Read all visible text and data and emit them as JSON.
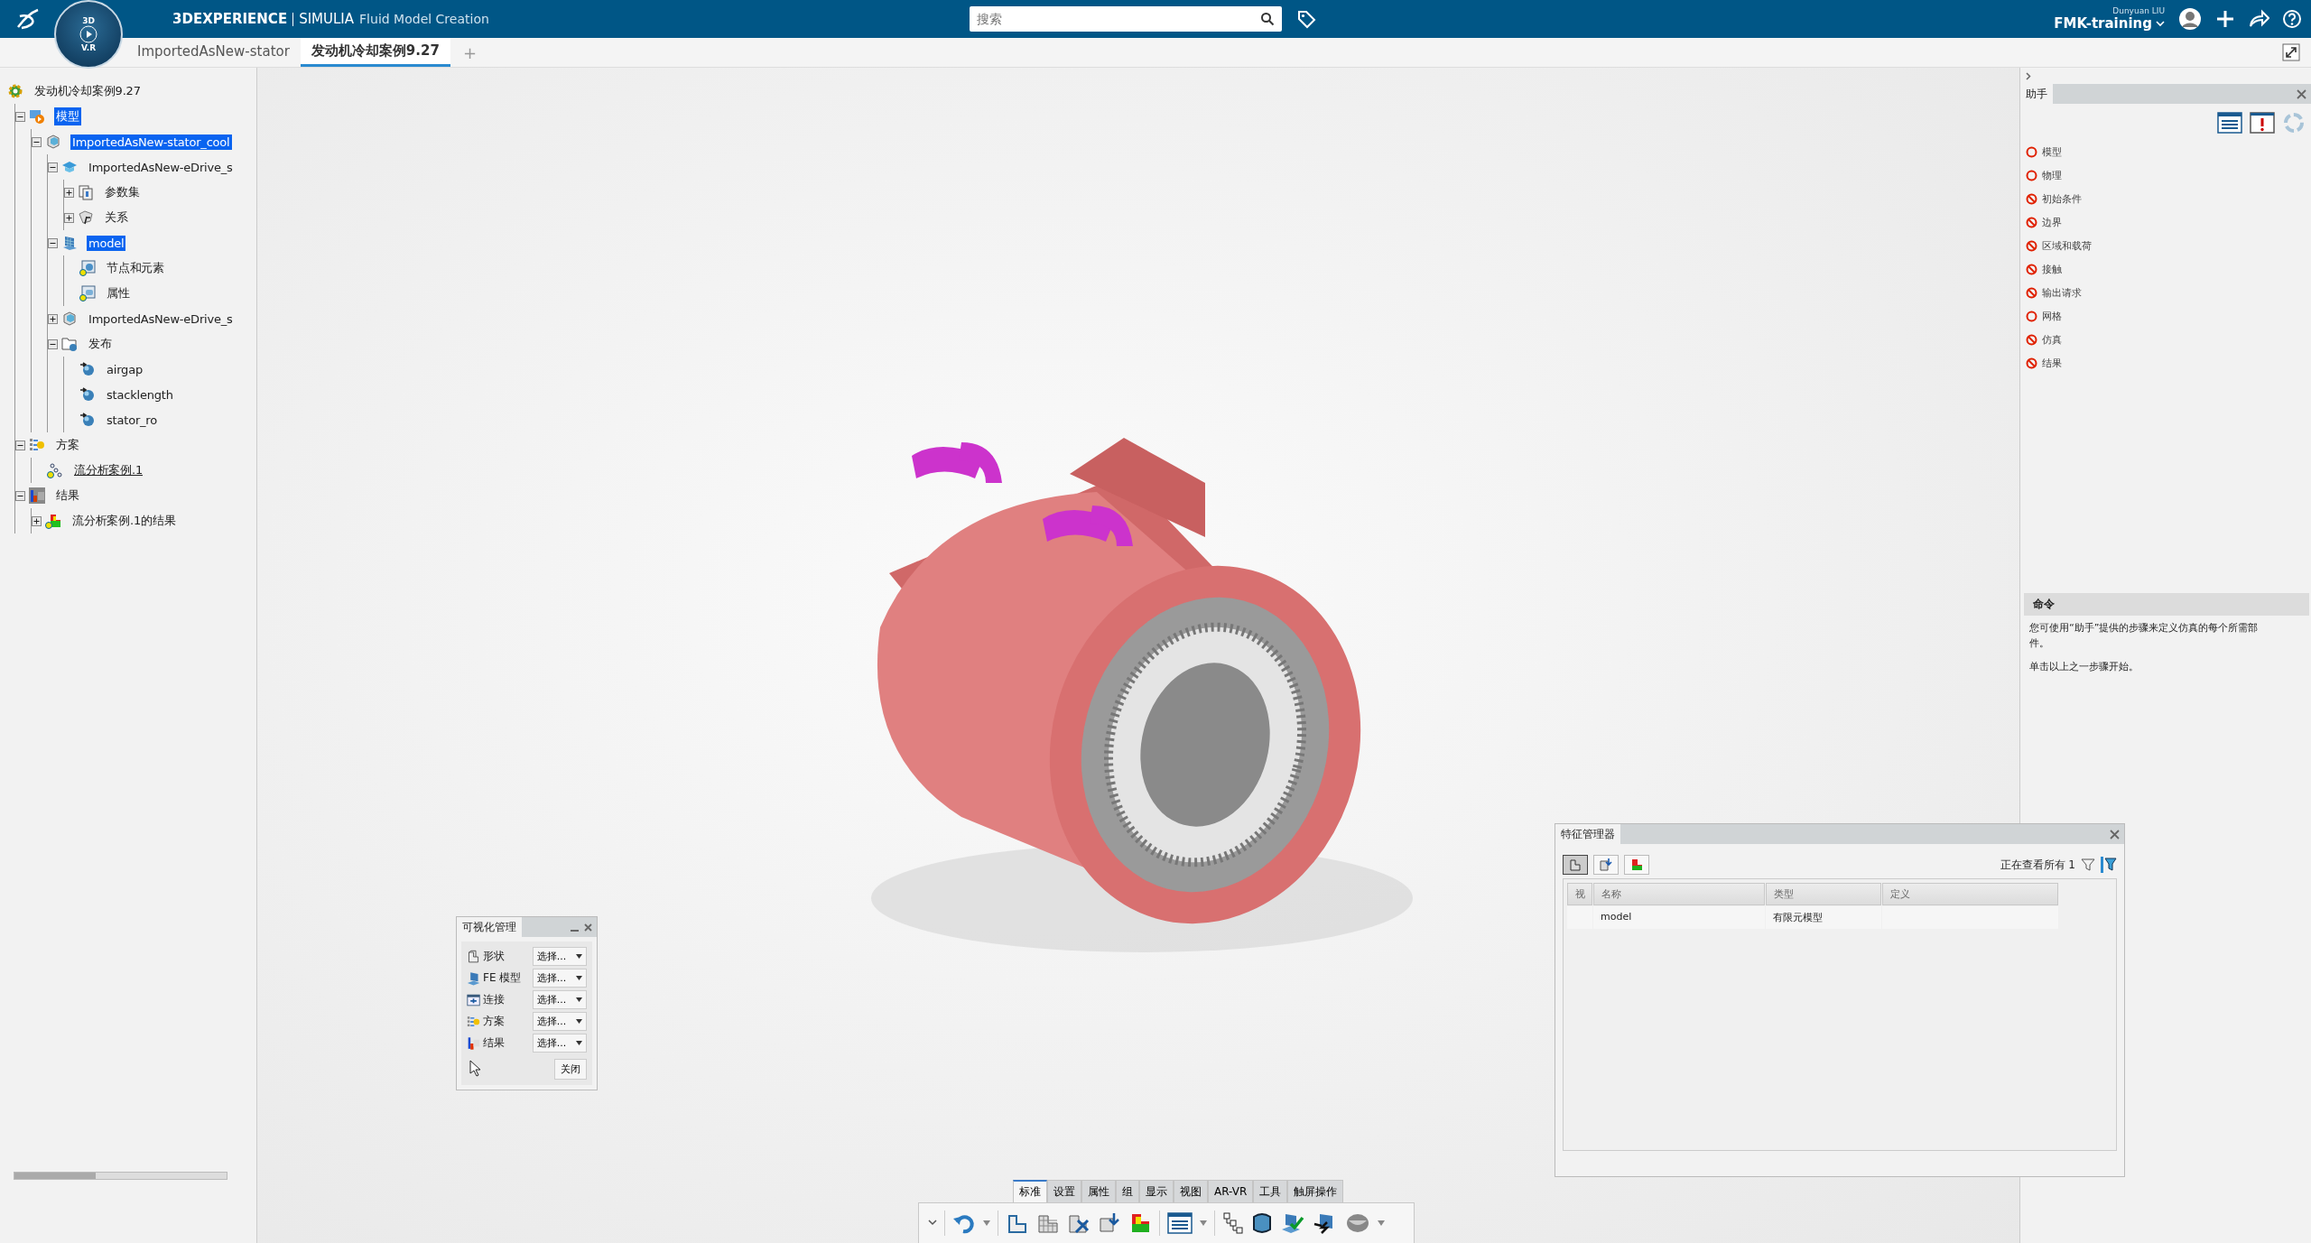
{
  "top_bar": {
    "compass_labels": [
      "3D",
      "V.R"
    ],
    "brand": "3DEXPERIENCE",
    "platform": "SIMULIA",
    "app": "Fluid Model Creation",
    "search": {
      "placeholder": "搜索"
    },
    "user": "Dunyuan LIU",
    "space": "FMK-training"
  },
  "tabs": [
    {
      "label": "ImportedAsNew-stator",
      "selected": false
    },
    {
      "label": "发动机冷却案例9.27",
      "selected": true
    }
  ],
  "new_tab": "+",
  "tree": {
    "label": "发动机冷却案例9.27",
    "kind": "root",
    "children": [
      {
        "label": "模型",
        "kind": "model",
        "expanded": true,
        "selected": true,
        "current": false,
        "children": [
          {
            "label": "ImportedAsNew-stator_cool",
            "kind": "product",
            "expanded": true,
            "selected": true,
            "current": false,
            "children": [
              {
                "label": "ImportedAsNew-eDrive_s",
                "kind": "part",
                "expanded": true,
                "selected": false,
                "current": false,
                "children": [
                  {
                    "label": "参数集",
                    "kind": "params",
                    "expanded": false,
                    "selected": false,
                    "current": false
                  },
                  {
                    "label": "关系",
                    "kind": "relations",
                    "expanded": false,
                    "selected": false,
                    "current": false
                  }
                ]
              },
              {
                "label": "model",
                "kind": "mesh",
                "expanded": true,
                "selected": true,
                "current": false,
                "children": [
                  {
                    "label": "节点和元素",
                    "kind": "nodes",
                    "selected": false,
                    "current": false
                  },
                  {
                    "label": "属性",
                    "kind": "props",
                    "selected": false,
                    "current": false
                  }
                ]
              },
              {
                "label": "ImportedAsNew-eDrive_s",
                "kind": "product",
                "expanded": false,
                "selected": false,
                "current": false
              },
              {
                "label": "发布",
                "kind": "folder",
                "expanded": true,
                "selected": false,
                "current": false,
                "children": [
                  {
                    "label": "airgap",
                    "kind": "publication",
                    "selected": false,
                    "current": false
                  },
                  {
                    "label": "stacklength",
                    "kind": "publication",
                    "selected": false,
                    "current": false
                  },
                  {
                    "label": "stator_ro",
                    "kind": "publication",
                    "selected": false,
                    "current": false
                  }
                ]
              }
            ]
          }
        ]
      },
      {
        "label": "方案",
        "kind": "scenario",
        "expanded": true,
        "selected": false,
        "current": false,
        "children": [
          {
            "label": "流分析案例.1",
            "kind": "sim",
            "selected": false,
            "current": true
          }
        ]
      },
      {
        "label": "结果",
        "kind": "results",
        "expanded": true,
        "selected": false,
        "current": false,
        "children": [
          {
            "label": "流分析案例.1的结果",
            "kind": "result",
            "expanded": false,
            "selected": false,
            "current": false
          }
        ]
      }
    ]
  },
  "visualization_manager": {
    "title": "可视化管理",
    "rows": [
      {
        "label": "形状",
        "kind": "shape",
        "value": "选择..."
      },
      {
        "label": "FE 模型",
        "kind": "fe",
        "value": "选择..."
      },
      {
        "label": "连接",
        "kind": "connection",
        "value": "选择..."
      },
      {
        "label": "方案",
        "kind": "scenario",
        "value": "选择..."
      },
      {
        "label": "结果",
        "kind": "results",
        "value": "选择..."
      }
    ],
    "close_button": "关闭"
  },
  "feature_manager": {
    "title": "特征管理器",
    "status": "正在查看所有 1",
    "columns": [
      "视",
      "名称",
      "类型",
      "定义"
    ],
    "rows": [
      {
        "name": "model",
        "type": "有限元模型"
      }
    ]
  },
  "assistant": {
    "tab": "助手",
    "steps": [
      {
        "label": "模型",
        "kind": "open"
      },
      {
        "label": "物理",
        "kind": "open"
      },
      {
        "label": "初始条件",
        "kind": "blocked"
      },
      {
        "label": "边界",
        "kind": "blocked"
      },
      {
        "label": "区域和载荷",
        "kind": "blocked"
      },
      {
        "label": "接触",
        "kind": "blocked"
      },
      {
        "label": "输出请求",
        "kind": "blocked"
      },
      {
        "label": "网格",
        "kind": "open"
      },
      {
        "label": "仿真",
        "kind": "blocked"
      },
      {
        "label": "结果",
        "kind": "blocked"
      }
    ],
    "command": {
      "title": "命令",
      "paragraphs": [
        "您可使用“助手”提供的步骤来定义仿真的每个所需部件。",
        "单击以上之一步骤开始。"
      ]
    }
  },
  "action_bar": {
    "tabs": [
      {
        "label": "标准",
        "selected": true
      },
      {
        "label": "设置",
        "selected": false
      },
      {
        "label": "属性",
        "selected": false
      },
      {
        "label": "组",
        "selected": false
      },
      {
        "label": "显示",
        "selected": false
      },
      {
        "label": "视图",
        "selected": false
      },
      {
        "label": "AR-VR",
        "selected": false
      },
      {
        "label": "工具",
        "selected": false
      },
      {
        "label": "触屏操作",
        "selected": false
      }
    ]
  }
}
